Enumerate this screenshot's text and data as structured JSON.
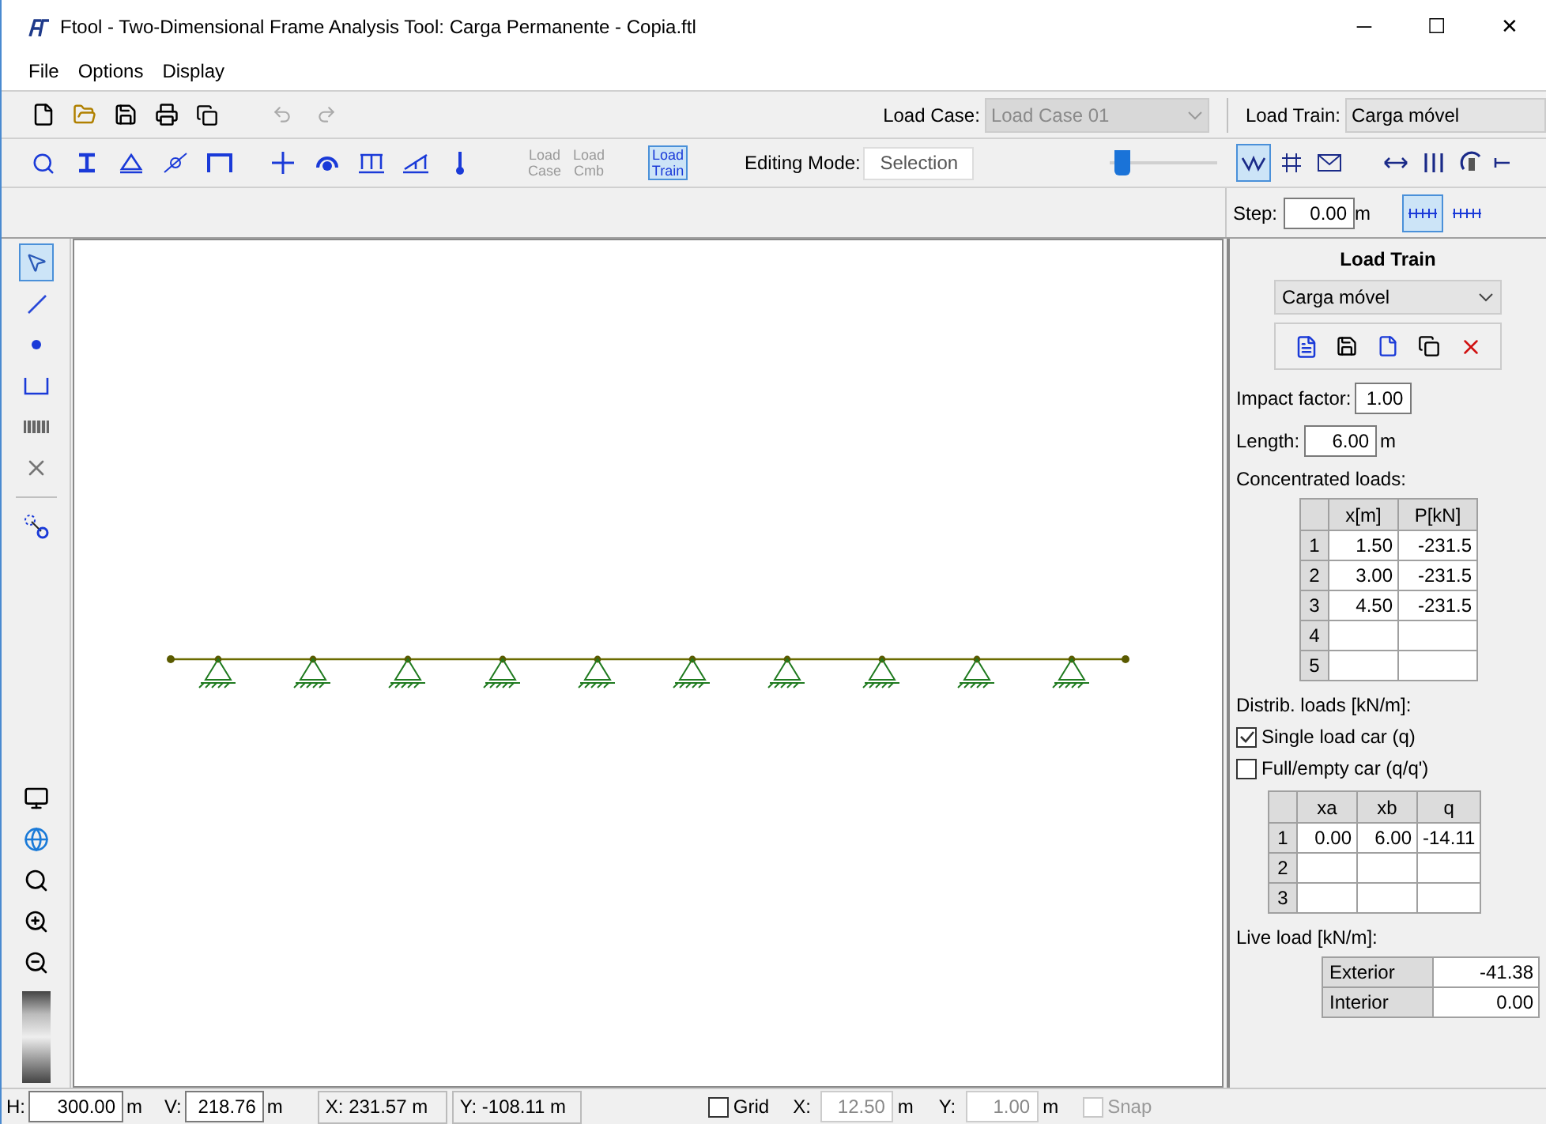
{
  "window": {
    "title": "Ftool - Two-Dimensional Frame Analysis Tool: Carga Permanente - Copia.ftl",
    "controls": [
      "─",
      "☐",
      "✕"
    ]
  },
  "menu": [
    "File",
    "Options",
    "Display"
  ],
  "toolbar": {
    "load_case": {
      "label": "Load Case:",
      "value": "Load Case 01",
      "disabled": true
    },
    "load_train": {
      "label": "Load Train:",
      "value": "Carga móvel"
    }
  },
  "load_buttons": [
    {
      "label": "Load Case",
      "selected": false,
      "disabled": true
    },
    {
      "label": "Load Cmb",
      "selected": false,
      "disabled": true
    },
    {
      "label": "Load Train",
      "selected": true,
      "disabled": false
    }
  ],
  "editing_mode": {
    "label": "Editing Mode:",
    "value": "Selection"
  },
  "scale_slider": {
    "level": 0.05
  },
  "view_tools": [
    {
      "selected": true
    },
    {
      "selected": false
    },
    {
      "selected": false
    }
  ],
  "step": {
    "label": "Step:",
    "value": "0.00",
    "unit": "m",
    "modes": [
      {
        "selected": true
      },
      {
        "selected": false
      }
    ]
  },
  "left_tools": [
    {
      "selected": true
    },
    {
      "selected": false
    },
    {
      "selected": false
    },
    {
      "selected": false
    },
    {
      "selected": false
    },
    {
      "selected": false
    }
  ],
  "panel": {
    "title": "Load Train",
    "train": "Carga móvel",
    "impact_factor": {
      "label": "Impact factor:",
      "value": "1.00"
    },
    "length": {
      "label": "Length:",
      "value": "6.00",
      "unit": "m"
    },
    "concentrated": {
      "label": "Concentrated loads:",
      "columns": [
        "x[m]",
        "P[kN]"
      ],
      "rows": [
        {
          "index": "1",
          "cells": [
            "1.50",
            "-231.5"
          ]
        },
        {
          "index": "2",
          "cells": [
            "3.00",
            "-231.5"
          ]
        },
        {
          "index": "3",
          "cells": [
            "4.50",
            "-231.5"
          ]
        },
        {
          "index": "4",
          "cells": [
            "",
            ""
          ]
        },
        {
          "index": "5",
          "cells": [
            "",
            ""
          ]
        }
      ]
    },
    "distrib": {
      "label": "Distrib. loads [kN/m]:",
      "options": [
        {
          "label": "Single load car (q)",
          "checked": true
        },
        {
          "label": "Full/empty car (q/q')",
          "checked": false
        }
      ],
      "columns": [
        "xa",
        "xb",
        "q"
      ],
      "rows": [
        {
          "index": "1",
          "cells": [
            "0.00",
            "6.00",
            "-14.11"
          ]
        },
        {
          "index": "2",
          "cells": [
            "",
            "",
            ""
          ]
        },
        {
          "index": "3",
          "cells": [
            "",
            "",
            ""
          ]
        }
      ]
    },
    "live_load": {
      "label": "Live load [kN/m]:",
      "rows": [
        {
          "name": "Exterior",
          "value": "-41.38"
        },
        {
          "name": "Interior",
          "value": "0.00"
        }
      ]
    }
  },
  "status_bar": {
    "h": {
      "label": "H:",
      "value": "300.00",
      "unit": "m"
    },
    "v": {
      "label": "V:",
      "value": "218.76",
      "unit": "m"
    },
    "x_coord": "X: 231.57 m",
    "y_coord": "Y: -108.11 m",
    "grid": {
      "label": "Grid",
      "checked": false
    },
    "grid_x": {
      "label": "X:",
      "value": "12.50",
      "unit": "m",
      "disabled": true
    },
    "grid_y": {
      "label": "Y:",
      "value": "1.00",
      "unit": "m",
      "disabled": true
    },
    "snap": {
      "label": "Snap",
      "checked": false,
      "disabled": true
    }
  }
}
